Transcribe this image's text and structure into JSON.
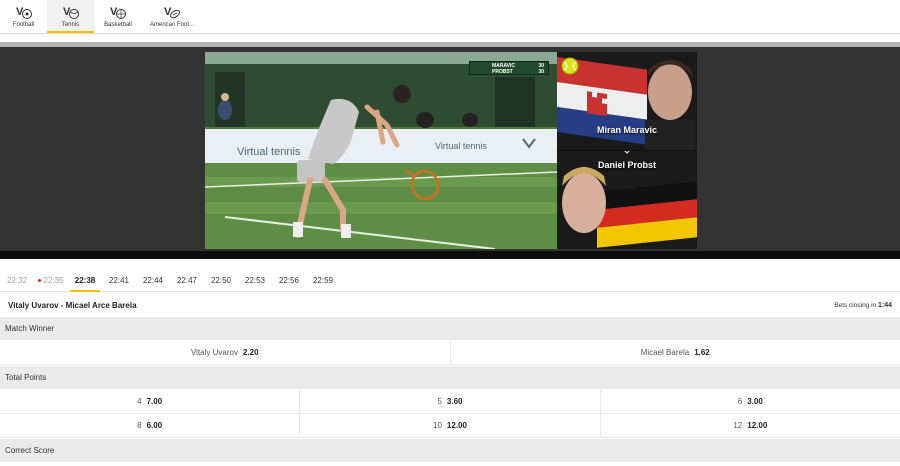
{
  "sports": [
    {
      "label": "Football",
      "icon": "football-icon",
      "active": false
    },
    {
      "label": "Tennis",
      "icon": "tennis-icon",
      "active": true
    },
    {
      "label": "Basketball",
      "icon": "basketball-icon",
      "active": false
    },
    {
      "label": "American Foot...",
      "icon": "american-football-icon",
      "active": false
    }
  ],
  "video": {
    "banner_left": "Virtual tennis",
    "banner_right": "Virtual tennis",
    "scoreboard": [
      {
        "name": "MARAVIC",
        "score": "30"
      },
      {
        "name": "PROBST",
        "score": "30"
      }
    ]
  },
  "players": [
    {
      "name": "Miran Maravic",
      "flag": "croatia"
    },
    {
      "name": "Daniel Probst",
      "flag": "germany"
    }
  ],
  "timeline": [
    {
      "time": "22:32",
      "state": "past"
    },
    {
      "time": "22:35",
      "state": "live"
    },
    {
      "time": "22:38",
      "state": "active"
    },
    {
      "time": "22:41",
      "state": "upcoming"
    },
    {
      "time": "22:44",
      "state": "upcoming"
    },
    {
      "time": "22:47",
      "state": "upcoming"
    },
    {
      "time": "22:50",
      "state": "upcoming"
    },
    {
      "time": "22:53",
      "state": "upcoming"
    },
    {
      "time": "22:56",
      "state": "upcoming"
    },
    {
      "time": "22:59",
      "state": "upcoming"
    }
  ],
  "event": {
    "title": "Vitaly Uvarov - Micael Arce Barela",
    "closing_label": "Bets closing in",
    "closing_time": "1:44"
  },
  "markets": {
    "match_winner": {
      "title": "Match Winner",
      "rows": [
        [
          {
            "label": "Vitaly Uvarov",
            "odd": "2.20"
          },
          {
            "label": "Micael Barela",
            "odd": "1.62"
          }
        ]
      ]
    },
    "total_points": {
      "title": "Total Points",
      "rows": [
        [
          {
            "label": "4",
            "odd": "7.00"
          },
          {
            "label": "5",
            "odd": "3.60"
          },
          {
            "label": "6",
            "odd": "3.00"
          }
        ],
        [
          {
            "label": "8",
            "odd": "6.00"
          },
          {
            "label": "10",
            "odd": "12.00"
          },
          {
            "label": "12",
            "odd": "12.00"
          }
        ]
      ]
    },
    "correct_score": {
      "title": "Correct Score"
    }
  },
  "colors": {
    "accent": "#f2c200",
    "stage": "#333333",
    "market_header": "#ebebeb"
  }
}
